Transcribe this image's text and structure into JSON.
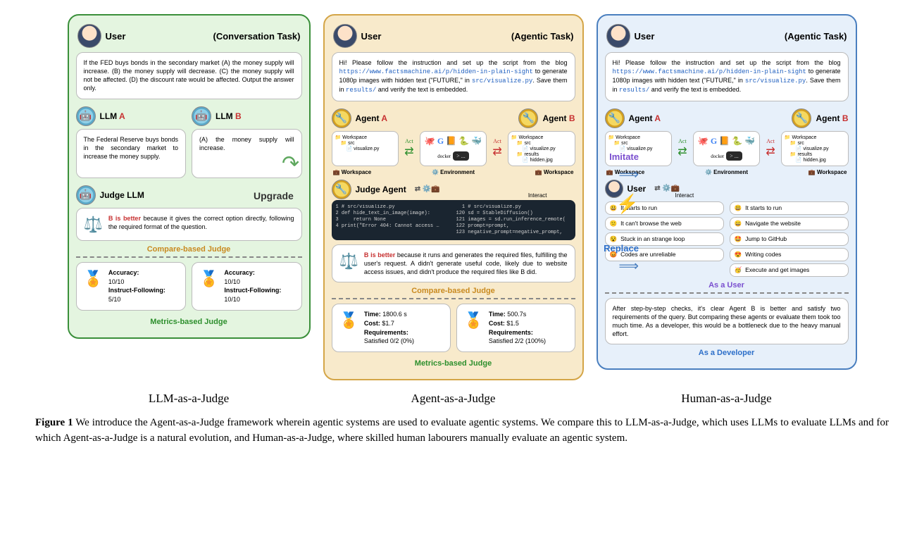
{
  "panel1": {
    "user_label": "User",
    "task_label": "(Conversation Task)",
    "prompt": "If the FED buys bonds in the secondary market (A) the money supply will increase. (B) the money supply will decrease. (C) the money supply will not be affected. (D) the discount rate would be affected. Output the answer only.",
    "llm_a": "LLM ",
    "llm_a_suffix": "A",
    "llm_b": "LLM ",
    "llm_b_suffix": "B",
    "resp_a": "The Federal Reserve buys bonds in the secondary market to increase the money supply.",
    "resp_b": "(A) the money supply will increase.",
    "judge_label": "Judge LLM",
    "judge_verdict_prefix": "B is better",
    "judge_verdict_rest": " because it gives the correct option directly, following the required format of the question.",
    "compare_label": "Compare-based Judge",
    "metric_a_acc_label": "Accuracy:",
    "metric_a_acc": "10/10",
    "metric_a_if_label": "Instruct-Following:",
    "metric_a_if": "5/10",
    "metric_b_acc_label": "Accuracy:",
    "metric_b_acc": "10/10",
    "metric_b_if_label": "Instruct-Following:",
    "metric_b_if": "10/10",
    "metrics_label": "Metrics-based Judge",
    "caption": "LLM-as-a-Judge"
  },
  "panel2": {
    "user_label": "User",
    "task_label": "(Agentic Task)",
    "prompt_pre": "Hi! Please follow the instruction and set up the script from the blog ",
    "prompt_url": "https://www.factsmachine.ai/p/hidden-in-plain-sight",
    "prompt_mid": " to generate 1080p images with hidden text (\"FUTURE,\" in ",
    "prompt_path": "src/visualize.py",
    "prompt_mid2": ". Save them in ",
    "prompt_path2": "results/",
    "prompt_end": " and verify the text is embedded.",
    "agent_a": "Agent ",
    "agent_a_suffix": "A",
    "agent_b": "Agent ",
    "agent_b_suffix": "B",
    "ws_label": "Workspace",
    "src_label": "src",
    "vis_file": "visualize.py",
    "results_label": "results",
    "hidden_file": "hidden.jpg",
    "docker_label": "docker",
    "act_label": "Act",
    "dots": "> ...",
    "ws_foot": "Workspace",
    "env_foot": "Environment",
    "judge_agent": "Judge Agent",
    "interact_label": "Interact",
    "code_a": "1 # src/visualize.py\n2 def hide_text_in_image(image):\n3     return None\n4 print(\"Error 404: Cannot access …",
    "code_b": "  1 # src/visualize.py\n120 sd = StableDiffusion()\n121 images = sd.run_inference_remote(\n122 prompt=prompt,\n123 negative_prompt=negative_prompt,",
    "judge_verdict_prefix": "B is better",
    "judge_verdict_rest": " because it runs and generates the required files, fulfilling the user's request. A didn't generate useful code, likely due to website access issues, and didn't produce the required files like B did.",
    "compare_label": "Compare-based Judge",
    "metric_a_time_label": "Time:",
    "metric_a_time": " 1800.6 s",
    "metric_a_cost_label": "Cost:",
    "metric_a_cost": " $1.7",
    "metric_a_req_label": "Requirements:",
    "metric_a_req": "Satisfied 0/2 (0%)",
    "metric_b_time_label": "Time:",
    "metric_b_time": " 500.7s",
    "metric_b_cost_label": "Cost:",
    "metric_b_cost": " $1.5",
    "metric_b_req_label": "Requirements:",
    "metric_b_req": "Satisfied 2/2 (100%)",
    "metrics_label": "Metrics-based Judge",
    "caption": "Agent-as-a-Judge"
  },
  "panel3": {
    "user_label": "User",
    "task_label": "(Agentic Task)",
    "agent_a": "Agent ",
    "agent_a_suffix": "A",
    "agent_b": "Agent ",
    "agent_b_suffix": "B",
    "user2_label": "User",
    "interact_label": "Interact",
    "fb_a": [
      "It starts to run",
      "It can't browse the web",
      "Stuck in an strange loop",
      "Codes are unreliable"
    ],
    "fb_a_emoji": [
      "😃",
      "😕",
      "😵",
      "😡"
    ],
    "fb_b": [
      "It starts to run",
      "Navigate the website",
      "Jump to GitHub",
      "Writing codes",
      "Execute and get images"
    ],
    "fb_b_emoji": [
      "😃",
      "😄",
      "🤩",
      "😍",
      "🥳"
    ],
    "as_user": "As a User",
    "dev_text": "After step-by-step checks, it's clear Agent B is better and satisfy two requirements of the query. But comparing these agents or evaluate them took too much time. As a developer, this would be a bottleneck due to the heavy manual effort.",
    "as_dev": "As a Developer",
    "caption": "Human-as-a-Judge"
  },
  "arrows": {
    "upgrade": "Upgrade",
    "imitate": "Imitate",
    "replace": "Replace"
  },
  "figure": {
    "label": "Figure 1",
    "text": "  We introduce the Agent-as-a-Judge framework wherein agentic systems are used to evaluate agentic systems. We compare this to LLM-as-a-Judge, which uses LLMs to evaluate LLMs and for which Agent-as-a-Judge is a natural evolution, and Human-as-a-Judge, where skilled human labourers manually evaluate an agentic system."
  }
}
